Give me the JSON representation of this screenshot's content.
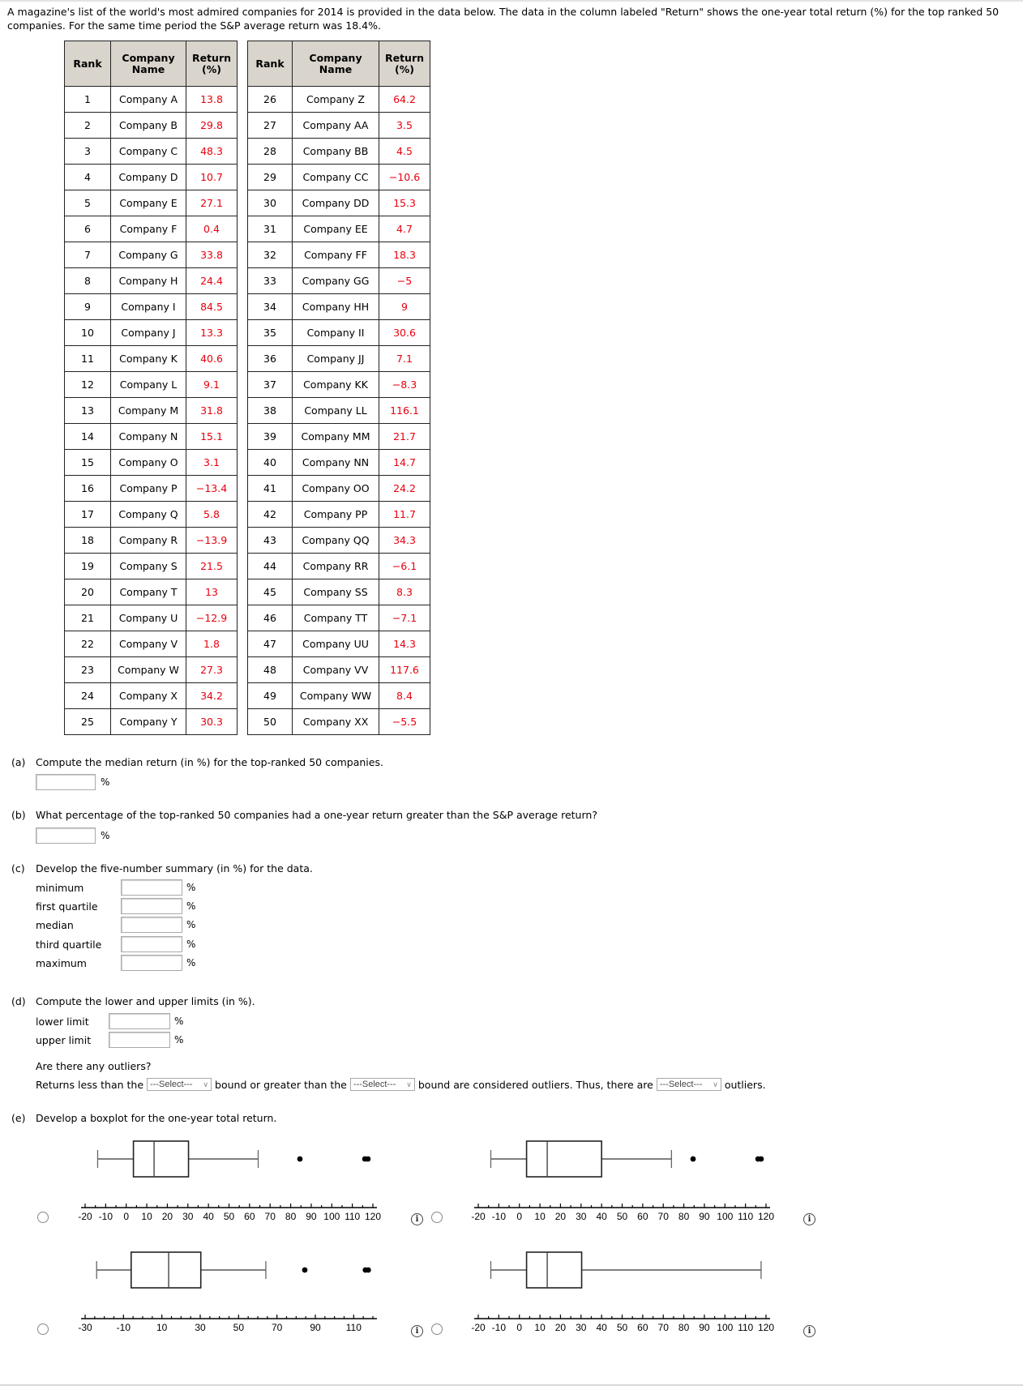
{
  "intro": "A magazine's list of the world's most admired companies for 2014 is provided in the data below. The data in the column labeled \"Return\" shows the one-year total return (%) for the top ranked 50 companies. For the same time period the S&P average return was 18.4%.",
  "table": {
    "headers": {
      "rank": "Rank",
      "name": "Company Name",
      "return": "Return (%)"
    },
    "left_rows": [
      {
        "rank": "1",
        "name": "Company A",
        "return": "13.8"
      },
      {
        "rank": "2",
        "name": "Company B",
        "return": "29.8"
      },
      {
        "rank": "3",
        "name": "Company C",
        "return": "48.3"
      },
      {
        "rank": "4",
        "name": "Company D",
        "return": "10.7"
      },
      {
        "rank": "5",
        "name": "Company E",
        "return": "27.1"
      },
      {
        "rank": "6",
        "name": "Company F",
        "return": "0.4"
      },
      {
        "rank": "7",
        "name": "Company G",
        "return": "33.8"
      },
      {
        "rank": "8",
        "name": "Company H",
        "return": "24.4"
      },
      {
        "rank": "9",
        "name": "Company I",
        "return": "84.5"
      },
      {
        "rank": "10",
        "name": "Company J",
        "return": "13.3"
      },
      {
        "rank": "11",
        "name": "Company K",
        "return": "40.6"
      },
      {
        "rank": "12",
        "name": "Company L",
        "return": "9.1"
      },
      {
        "rank": "13",
        "name": "Company M",
        "return": "31.8"
      },
      {
        "rank": "14",
        "name": "Company N",
        "return": "15.1"
      },
      {
        "rank": "15",
        "name": "Company O",
        "return": "3.1"
      },
      {
        "rank": "16",
        "name": "Company P",
        "return": "−13.4"
      },
      {
        "rank": "17",
        "name": "Company Q",
        "return": "5.8"
      },
      {
        "rank": "18",
        "name": "Company R",
        "return": "−13.9"
      },
      {
        "rank": "19",
        "name": "Company S",
        "return": "21.5"
      },
      {
        "rank": "20",
        "name": "Company T",
        "return": "13"
      },
      {
        "rank": "21",
        "name": "Company U",
        "return": "−12.9"
      },
      {
        "rank": "22",
        "name": "Company V",
        "return": "1.8"
      },
      {
        "rank": "23",
        "name": "Company W",
        "return": "27.3"
      },
      {
        "rank": "24",
        "name": "Company X",
        "return": "34.2"
      },
      {
        "rank": "25",
        "name": "Company Y",
        "return": "30.3"
      }
    ],
    "right_rows": [
      {
        "rank": "26",
        "name": "Company Z",
        "return": "64.2"
      },
      {
        "rank": "27",
        "name": "Company AA",
        "return": "3.5"
      },
      {
        "rank": "28",
        "name": "Company BB",
        "return": "4.5"
      },
      {
        "rank": "29",
        "name": "Company CC",
        "return": "−10.6"
      },
      {
        "rank": "30",
        "name": "Company DD",
        "return": "15.3"
      },
      {
        "rank": "31",
        "name": "Company EE",
        "return": "4.7"
      },
      {
        "rank": "32",
        "name": "Company FF",
        "return": "18.3"
      },
      {
        "rank": "33",
        "name": "Company GG",
        "return": "−5"
      },
      {
        "rank": "34",
        "name": "Company HH",
        "return": "9"
      },
      {
        "rank": "35",
        "name": "Company II",
        "return": "30.6"
      },
      {
        "rank": "36",
        "name": "Company JJ",
        "return": "7.1"
      },
      {
        "rank": "37",
        "name": "Company KK",
        "return": "−8.3"
      },
      {
        "rank": "38",
        "name": "Company LL",
        "return": "116.1"
      },
      {
        "rank": "39",
        "name": "Company MM",
        "return": "21.7"
      },
      {
        "rank": "40",
        "name": "Company NN",
        "return": "14.7"
      },
      {
        "rank": "41",
        "name": "Company OO",
        "return": "24.2"
      },
      {
        "rank": "42",
        "name": "Company PP",
        "return": "11.7"
      },
      {
        "rank": "43",
        "name": "Company QQ",
        "return": "34.3"
      },
      {
        "rank": "44",
        "name": "Company RR",
        "return": "−6.1"
      },
      {
        "rank": "45",
        "name": "Company SS",
        "return": "8.3"
      },
      {
        "rank": "46",
        "name": "Company TT",
        "return": "−7.1"
      },
      {
        "rank": "47",
        "name": "Company UU",
        "return": "14.3"
      },
      {
        "rank": "48",
        "name": "Company VV",
        "return": "117.6"
      },
      {
        "rank": "49",
        "name": "Company WW",
        "return": "8.4"
      },
      {
        "rank": "50",
        "name": "Company XX",
        "return": "−5.5"
      }
    ]
  },
  "part_a": {
    "label": "(a)",
    "text": "Compute the median return (in %) for the top-ranked 50 companies.",
    "value": "",
    "unit": "%"
  },
  "part_b": {
    "label": "(b)",
    "text": "What percentage of the top-ranked 50 companies had a one-year return greater than the S&P average return?",
    "value": "",
    "unit": "%"
  },
  "part_c": {
    "label": "(c)",
    "text": "Develop the five-number summary (in %) for the data.",
    "rows": [
      {
        "label": "minimum",
        "value": "",
        "unit": "%"
      },
      {
        "label": "first quartile",
        "value": "",
        "unit": "%"
      },
      {
        "label": "median",
        "value": "",
        "unit": "%"
      },
      {
        "label": "third quartile",
        "value": "",
        "unit": "%"
      },
      {
        "label": "maximum",
        "value": "",
        "unit": "%"
      }
    ]
  },
  "part_d": {
    "label": "(d)",
    "text": "Compute the lower and upper limits (in %).",
    "lower": {
      "label": "lower limit",
      "value": "",
      "unit": "%"
    },
    "upper": {
      "label": "upper limit",
      "value": "",
      "unit": "%"
    },
    "outlier_question": "Are there any outliers?",
    "sentence": {
      "part1": "Returns less than the",
      "part2": "bound or greater than the",
      "part3": "bound are considered outliers. Thus, there are",
      "part4": "outliers.",
      "select_placeholder": "---Select---"
    }
  },
  "part_e": {
    "label": "(e)",
    "text": "Develop a boxplot for the one-year total return."
  },
  "chart_data": [
    {
      "type": "boxplot",
      "option": 1,
      "selected": false,
      "axis": {
        "min": -20,
        "max": 120,
        "major_step": 10,
        "minor_step": 5,
        "tick_labels": [
          "-20",
          "-10",
          "0",
          "10",
          "20",
          "30",
          "40",
          "50",
          "60",
          "70",
          "80",
          "90",
          "100",
          "110",
          "120"
        ]
      },
      "whisker_low": -13.9,
      "q1": 3.5,
      "median": 13.55,
      "q3": 30.3,
      "whisker_high": 64.2,
      "outliers": [
        84.5,
        116.1,
        117.6
      ]
    },
    {
      "type": "boxplot",
      "option": 2,
      "selected": false,
      "axis": {
        "min": -20,
        "max": 120,
        "major_step": 10,
        "minor_step": 5,
        "tick_labels": [
          "-20",
          "-10",
          "0",
          "10",
          "20",
          "30",
          "40",
          "50",
          "60",
          "70",
          "80",
          "90",
          "100",
          "110",
          "120"
        ]
      },
      "whisker_low": -13.9,
      "q1": 3.5,
      "median": 13.55,
      "q3": 40.0,
      "whisker_high": 74.0,
      "outliers": [
        84.5,
        116.1,
        117.6
      ]
    },
    {
      "type": "boxplot",
      "option": 3,
      "selected": false,
      "axis": {
        "min": -30,
        "max": 120,
        "major_step": 20,
        "minor_step": 5,
        "tick_labels": [
          "-30",
          "-10",
          "10",
          "30",
          "50",
          "70",
          "90",
          "110"
        ]
      },
      "whisker_low": -24,
      "q1": -6,
      "median": 13.55,
      "q3": 30.3,
      "whisker_high": 64.2,
      "outliers": [
        84.5,
        116.1,
        117.6
      ]
    },
    {
      "type": "boxplot",
      "option": 4,
      "selected": false,
      "axis": {
        "min": -20,
        "max": 120,
        "major_step": 10,
        "minor_step": 5,
        "tick_labels": [
          "-20",
          "-10",
          "0",
          "10",
          "20",
          "30",
          "40",
          "50",
          "60",
          "70",
          "80",
          "90",
          "100",
          "110",
          "120"
        ]
      },
      "whisker_low": -13.9,
      "q1": 3.5,
      "median": 13.55,
      "q3": 30.3,
      "whisker_high": 117.6,
      "outliers": []
    }
  ],
  "icons": {
    "info": "info-icon",
    "radio": "radio-button"
  },
  "info_glyph": "i"
}
